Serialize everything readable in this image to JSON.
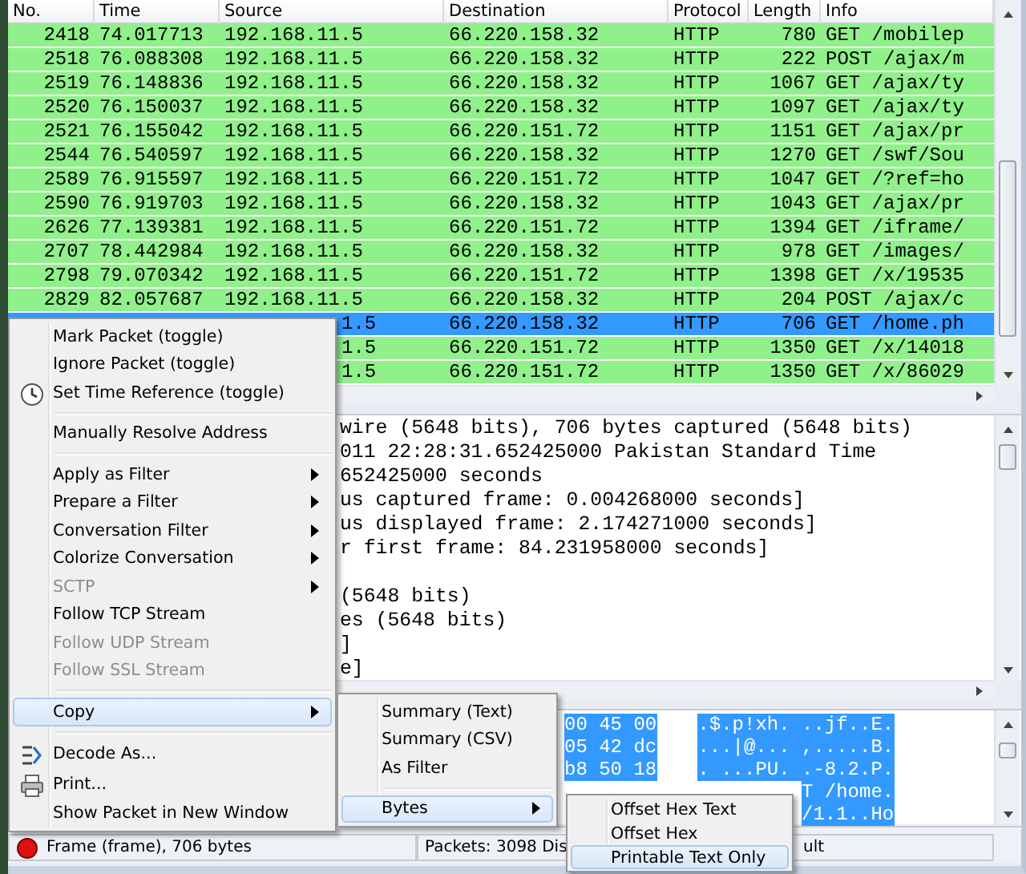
{
  "packet_list": {
    "columns": [
      "No.",
      "Time",
      "Source",
      "Destination",
      "Protocol",
      "Length",
      "Info"
    ],
    "rows": [
      {
        "kind": "full",
        "no": "2418",
        "time": "74.017713",
        "source": "192.168.11.5",
        "destination": "66.220.158.32",
        "protocol": "HTTP",
        "length": "780",
        "info": "GET /mobilep",
        "selected": false
      },
      {
        "kind": "full",
        "no": "2518",
        "time": "76.088308",
        "source": "192.168.11.5",
        "destination": "66.220.158.32",
        "protocol": "HTTP",
        "length": "222",
        "info": "POST /ajax/m",
        "selected": false
      },
      {
        "kind": "full",
        "no": "2519",
        "time": "76.148836",
        "source": "192.168.11.5",
        "destination": "66.220.158.32",
        "protocol": "HTTP",
        "length": "1067",
        "info": "GET /ajax/ty",
        "selected": false
      },
      {
        "kind": "full",
        "no": "2520",
        "time": "76.150037",
        "source": "192.168.11.5",
        "destination": "66.220.158.32",
        "protocol": "HTTP",
        "length": "1097",
        "info": "GET /ajax/ty",
        "selected": false
      },
      {
        "kind": "full",
        "no": "2521",
        "time": "76.155042",
        "source": "192.168.11.5",
        "destination": "66.220.151.72",
        "protocol": "HTTP",
        "length": "1151",
        "info": "GET /ajax/pr",
        "selected": false
      },
      {
        "kind": "full",
        "no": "2544",
        "time": "76.540597",
        "source": "192.168.11.5",
        "destination": "66.220.158.32",
        "protocol": "HTTP",
        "length": "1270",
        "info": "GET /swf/Sou",
        "selected": false
      },
      {
        "kind": "full",
        "no": "2589",
        "time": "76.915597",
        "source": "192.168.11.5",
        "destination": "66.220.151.72",
        "protocol": "HTTP",
        "length": "1047",
        "info": "GET /?ref=ho",
        "selected": false
      },
      {
        "kind": "full",
        "no": "2590",
        "time": "76.919703",
        "source": "192.168.11.5",
        "destination": "66.220.158.32",
        "protocol": "HTTP",
        "length": "1043",
        "info": "GET /ajax/pr",
        "selected": false
      },
      {
        "kind": "full",
        "no": "2626",
        "time": "77.139381",
        "source": "192.168.11.5",
        "destination": "66.220.151.72",
        "protocol": "HTTP",
        "length": "1394",
        "info": "GET /iframe/",
        "selected": false
      },
      {
        "kind": "full",
        "no": "2707",
        "time": "78.442984",
        "source": "192.168.11.5",
        "destination": "66.220.158.32",
        "protocol": "HTTP",
        "length": "978",
        "info": "GET /images/",
        "selected": false
      },
      {
        "kind": "full",
        "no": "2798",
        "time": "79.070342",
        "source": "192.168.11.5",
        "destination": "66.220.151.72",
        "protocol": "HTTP",
        "length": "1398",
        "info": "GET /x/19535",
        "selected": false
      },
      {
        "kind": "full",
        "no": "2829",
        "time": "82.057687",
        "source": "192.168.11.5",
        "destination": "66.220.158.32",
        "protocol": "HTTP",
        "length": "204",
        "info": "POST /ajax/c",
        "selected": false
      },
      {
        "kind": "covered",
        "source": "1.5",
        "destination": "66.220.158.32",
        "protocol": "HTTP",
        "length": "706",
        "info": "GET /home.ph",
        "selected": true
      },
      {
        "kind": "covered",
        "source": "1.5",
        "destination": "66.220.151.72",
        "protocol": "HTTP",
        "length": "1350",
        "info": "GET /x/14018",
        "selected": false
      },
      {
        "kind": "covered",
        "source": "1.5",
        "destination": "66.220.151.72",
        "protocol": "HTTP",
        "length": "1350",
        "info": "GET /x/86029",
        "selected": false
      }
    ]
  },
  "details": {
    "lines": [
      "wire (5648 bits), 706 bytes captured (5648 bits)",
      "011 22:28:31.652425000 Pakistan Standard Time",
      "652425000 seconds",
      "us captured frame: 0.004268000 seconds]",
      "us displayed frame: 2.174271000 seconds]",
      "r first frame: 84.231958000 seconds]"
    ],
    "lines_below": [
      "(5648 bits)",
      "es (5648 bits)",
      "]",
      "e]"
    ]
  },
  "bytes": {
    "hex": [
      "00 45 00",
      "05 42 dc",
      "b8 50 18"
    ],
    "ascii": [
      ".$.p!xh. ..jf..E.",
      "...|@... ,.....B.",
      ". ...PU. .-8.2.P.",
      "T /home.",
      "/1.1..Ho"
    ]
  },
  "status_bar": {
    "frame": "Frame (frame), 706 bytes",
    "packets": "Packets: 3098 Dis",
    "profile": "ult"
  },
  "context_menu": {
    "items": [
      {
        "kind": "item",
        "label": "Mark Packet (toggle)",
        "icon": false,
        "submenu": false,
        "disabled": false,
        "selected": false
      },
      {
        "kind": "item",
        "label": "Ignore Packet (toggle)",
        "icon": false,
        "submenu": false,
        "disabled": false,
        "selected": false
      },
      {
        "kind": "item",
        "label": "Set Time Reference (toggle)",
        "icon": true,
        "submenu": false,
        "disabled": false,
        "selected": false
      },
      {
        "kind": "separator"
      },
      {
        "kind": "item",
        "label": "Manually Resolve Address",
        "icon": false,
        "submenu": false,
        "disabled": false,
        "selected": false
      },
      {
        "kind": "separator"
      },
      {
        "kind": "item",
        "label": "Apply as Filter",
        "icon": false,
        "submenu": true,
        "disabled": false,
        "selected": false
      },
      {
        "kind": "item",
        "label": "Prepare a Filter",
        "icon": false,
        "submenu": true,
        "disabled": false,
        "selected": false
      },
      {
        "kind": "item",
        "label": "Conversation Filter",
        "icon": false,
        "submenu": true,
        "disabled": false,
        "selected": false
      },
      {
        "kind": "item",
        "label": "Colorize Conversation",
        "icon": false,
        "submenu": true,
        "disabled": false,
        "selected": false
      },
      {
        "kind": "item",
        "label": "SCTP",
        "icon": false,
        "submenu": true,
        "disabled": true,
        "selected": false
      },
      {
        "kind": "item",
        "label": "Follow TCP Stream",
        "icon": false,
        "submenu": false,
        "disabled": false,
        "selected": false
      },
      {
        "kind": "item",
        "label": "Follow UDP Stream",
        "icon": false,
        "submenu": false,
        "disabled": true,
        "selected": false
      },
      {
        "kind": "item",
        "label": "Follow SSL Stream",
        "icon": false,
        "submenu": false,
        "disabled": true,
        "selected": false
      },
      {
        "kind": "separator"
      },
      {
        "kind": "item",
        "label": "Copy",
        "icon": false,
        "submenu": true,
        "disabled": false,
        "selected": true
      },
      {
        "kind": "separator"
      },
      {
        "kind": "item",
        "label": "Decode As...",
        "icon": true,
        "submenu": false,
        "disabled": false,
        "selected": false
      },
      {
        "kind": "item",
        "label": "Print...",
        "icon": true,
        "submenu": false,
        "disabled": false,
        "selected": false
      },
      {
        "kind": "item",
        "label": "Show Packet in New Window",
        "icon": false,
        "submenu": false,
        "disabled": false,
        "selected": false
      }
    ]
  },
  "copy_submenu": {
    "items": [
      {
        "kind": "item",
        "label": "Summary (Text)",
        "submenu": false,
        "disabled": false,
        "selected": false
      },
      {
        "kind": "item",
        "label": "Summary (CSV)",
        "submenu": false,
        "disabled": false,
        "selected": false
      },
      {
        "kind": "item",
        "label": "As Filter",
        "submenu": false,
        "disabled": false,
        "selected": false
      },
      {
        "kind": "separator"
      },
      {
        "kind": "item",
        "label": "Bytes",
        "submenu": true,
        "disabled": false,
        "selected": true
      }
    ]
  },
  "bytes_submenu": {
    "items": [
      {
        "kind": "item",
        "label": "Offset Hex Text",
        "submenu": false,
        "disabled": false,
        "selected": false
      },
      {
        "kind": "item",
        "label": "Offset Hex",
        "submenu": false,
        "disabled": false,
        "selected": false
      },
      {
        "kind": "item",
        "label": "Printable Text Only",
        "submenu": false,
        "disabled": false,
        "selected": true
      }
    ]
  }
}
